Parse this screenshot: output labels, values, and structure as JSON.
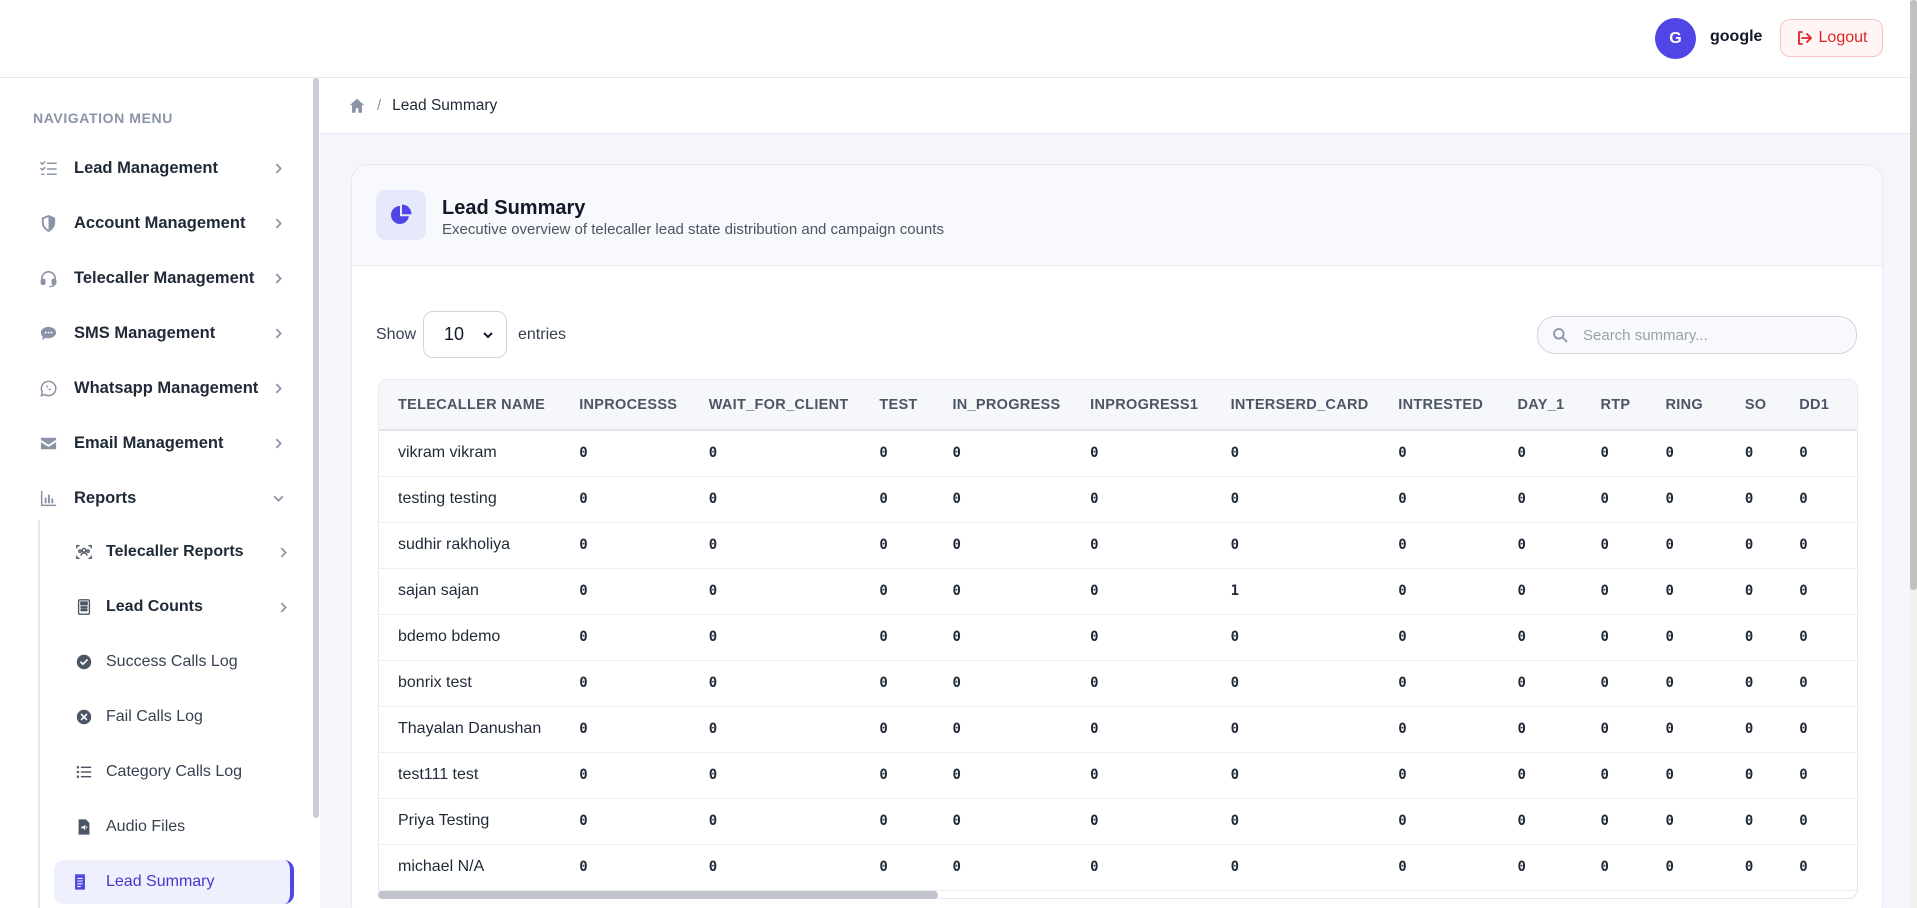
{
  "header": {
    "avatar_initial": "G",
    "username": "google",
    "logout_label": "Logout"
  },
  "sidebar": {
    "section_title": "NAVIGATION MENU",
    "items": [
      {
        "label": "Lead Management",
        "icon": "list-check-icon"
      },
      {
        "label": "Account Management",
        "icon": "shield-icon"
      },
      {
        "label": "Telecaller Management",
        "icon": "headset-icon"
      },
      {
        "label": "SMS Management",
        "icon": "chat-bubble-icon"
      },
      {
        "label": "Whatsapp Management",
        "icon": "whatsapp-icon"
      },
      {
        "label": "Email Management",
        "icon": "envelope-icon"
      },
      {
        "label": "Reports",
        "icon": "bar-chart-icon",
        "expanded": true
      }
    ],
    "report_items": [
      {
        "label": "Telecaller Reports",
        "icon": "users-scan-icon",
        "has_children": true
      },
      {
        "label": "Lead Counts",
        "icon": "calculator-icon",
        "has_children": true
      },
      {
        "label": "Success Calls Log",
        "icon": "check-circle-icon"
      },
      {
        "label": "Fail Calls Log",
        "icon": "x-circle-icon"
      },
      {
        "label": "Category Calls Log",
        "icon": "list-icon"
      },
      {
        "label": "Audio Files",
        "icon": "audio-file-icon"
      },
      {
        "label": "Lead Summary",
        "icon": "document-icon",
        "active": true
      }
    ]
  },
  "breadcrumb": {
    "separator": "/",
    "current": "Lead Summary"
  },
  "card": {
    "title": "Lead Summary",
    "subtitle": "Executive overview of telecaller lead state distribution and campaign counts"
  },
  "controls": {
    "show_label": "Show",
    "entries_value": "10",
    "entries_label": "entries",
    "search_placeholder": "Search summary..."
  },
  "table": {
    "columns": [
      "TELECALLER NAME",
      "INPROCESSS",
      "WAIT_FOR_CLIENT",
      "TEST",
      "IN_PROGRESS",
      "INPROGRESS1",
      "INTERSERD_CARD",
      "INTRESTED",
      "DAY_1",
      "RTP",
      "RING",
      "SO",
      "DD1"
    ],
    "rows": [
      {
        "name": "vikram vikram",
        "values": [
          "0",
          "0",
          "0",
          "0",
          "0",
          "0",
          "0",
          "0",
          "0",
          "0",
          "0",
          "0"
        ]
      },
      {
        "name": "testing testing",
        "values": [
          "0",
          "0",
          "0",
          "0",
          "0",
          "0",
          "0",
          "0",
          "0",
          "0",
          "0",
          "0"
        ]
      },
      {
        "name": "sudhir rakholiya",
        "values": [
          "0",
          "0",
          "0",
          "0",
          "0",
          "0",
          "0",
          "0",
          "0",
          "0",
          "0",
          "0"
        ]
      },
      {
        "name": "sajan sajan",
        "values": [
          "0",
          "0",
          "0",
          "0",
          "0",
          "1",
          "0",
          "0",
          "0",
          "0",
          "0",
          "0"
        ]
      },
      {
        "name": "bdemo bdemo",
        "values": [
          "0",
          "0",
          "0",
          "0",
          "0",
          "0",
          "0",
          "0",
          "0",
          "0",
          "0",
          "0"
        ]
      },
      {
        "name": "bonrix test",
        "values": [
          "0",
          "0",
          "0",
          "0",
          "0",
          "0",
          "0",
          "0",
          "0",
          "0",
          "0",
          "0"
        ]
      },
      {
        "name": "Thayalan Danushan",
        "values": [
          "0",
          "0",
          "0",
          "0",
          "0",
          "0",
          "0",
          "0",
          "0",
          "0",
          "0",
          "0"
        ]
      },
      {
        "name": "test111 test",
        "values": [
          "0",
          "0",
          "0",
          "0",
          "0",
          "0",
          "0",
          "0",
          "0",
          "0",
          "0",
          "0"
        ]
      },
      {
        "name": "Priya Testing",
        "values": [
          "0",
          "0",
          "0",
          "0",
          "0",
          "0",
          "0",
          "0",
          "0",
          "0",
          "0",
          "0"
        ]
      },
      {
        "name": "michael N/A",
        "values": [
          "0",
          "0",
          "0",
          "0",
          "0",
          "0",
          "0",
          "0",
          "0",
          "0",
          "0",
          "0"
        ]
      }
    ]
  },
  "colors": {
    "accent": "#4f46e5",
    "logout": "#dc2626"
  }
}
